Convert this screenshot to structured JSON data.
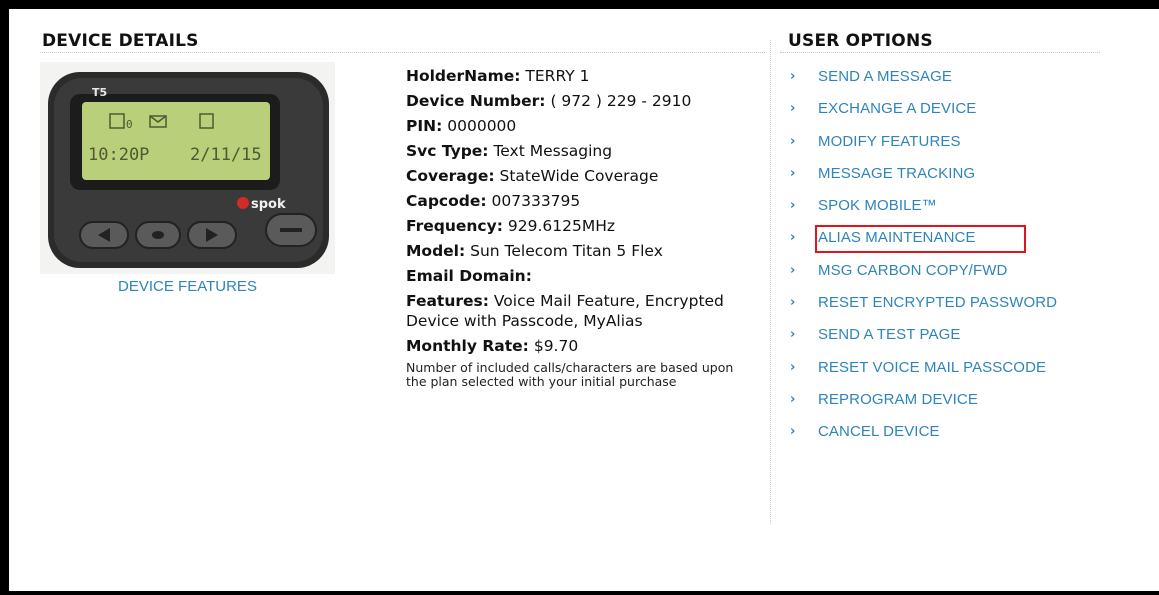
{
  "device_details": {
    "title": "DEVICE DETAILS",
    "device_features_link": "DEVICE FEATURES",
    "pager_image": {
      "model_label": "T5",
      "screen_time": "10:20P",
      "screen_date": "2/11/15",
      "screen_count": "0",
      "brand": "spok"
    },
    "fields": [
      {
        "label": "HolderName:",
        "value": "TERRY 1"
      },
      {
        "label": "Device Number:",
        "value": "( 972 ) 229 - 2910"
      },
      {
        "label": "PIN:",
        "value": "0000000"
      },
      {
        "label": "Svc Type:",
        "value": "Text Messaging"
      },
      {
        "label": "Coverage:",
        "value": "StateWide Coverage"
      },
      {
        "label": "Capcode:",
        "value": "007333795"
      },
      {
        "label": "Frequency:",
        "value": "929.6125MHz"
      },
      {
        "label": "Model:",
        "value": "Sun Telecom Titan 5 Flex"
      },
      {
        "label": "Email Domain:",
        "value": ""
      },
      {
        "label": "Features:",
        "value": "Voice Mail Feature, Encrypted Device with Passcode, MyAlias"
      },
      {
        "label": "Monthly Rate:",
        "value": "$9.70"
      }
    ],
    "note": "Number of included calls/characters are based upon the plan selected with your initial purchase"
  },
  "user_options": {
    "title": "USER OPTIONS",
    "items": [
      {
        "label": "SEND A MESSAGE"
      },
      {
        "label": "EXCHANGE A DEVICE"
      },
      {
        "label": "MODIFY FEATURES"
      },
      {
        "label": "MESSAGE TRACKING"
      },
      {
        "label": "SPOK MOBILE™"
      },
      {
        "label": "ALIAS MAINTENANCE",
        "highlighted": true
      },
      {
        "label": "MSG CARBON COPY/FWD"
      },
      {
        "label": "RESET ENCRYPTED PASSWORD"
      },
      {
        "label": "SEND A TEST PAGE"
      },
      {
        "label": "RESET VOICE MAIL PASSCODE"
      },
      {
        "label": "REPROGRAM DEVICE"
      },
      {
        "label": "CANCEL DEVICE"
      }
    ]
  },
  "colors": {
    "link": "#2f84b8",
    "highlight_border": "#e0141a",
    "pager_screen": "#b9cf7a",
    "pager_body": "#2a2a2a"
  }
}
